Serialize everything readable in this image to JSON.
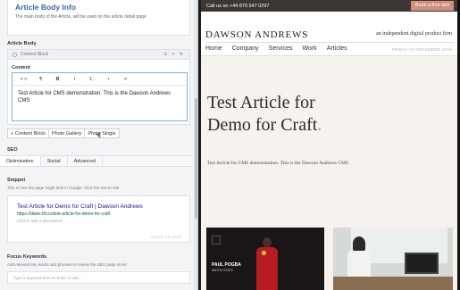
{
  "editor": {
    "section_title": "Article Body Info",
    "section_desc": "The main body of the Article, will be used on the article detail page",
    "article_body_label": "Article Body",
    "block_name": "Content Block",
    "block_tools": "⚙ ▾ ✥",
    "content_label": "Content",
    "toolbar": [
      "<>",
      "¶",
      "B",
      "I",
      "1.",
      "•",
      "∞"
    ],
    "content_text": "Test Article for CMS demonstration. This is the Dawson Andrews CMS",
    "add_buttons": [
      "+ Content Block",
      "Photo Gallery",
      "Photo Single"
    ],
    "seo_label": "SEO",
    "seo_tabs": [
      "Optimisation",
      "Social",
      "Advanced"
    ],
    "snippet_label": "Snippet",
    "snippet_hint": "This is how the page might look in Google. Click the text to edit",
    "snippet_title": "Test Article for Demo for Craft  | Dawson Andrews",
    "snippet_url": "https://daws.frb.io/test-article-for-demo-for-craft",
    "snippet_desc": "Click to add a description!",
    "snippet_click": "CLICK TO EDIT",
    "focus_label": "Focus Keywords",
    "focus_hint": "Add relevant key words and phrases to review the SEO page score",
    "focus_placeholder": "Type a keyword then hit enter to add..."
  },
  "preview": {
    "call_text": "Call us on +44 870 947 0297",
    "book_button": "Book a free slot",
    "logo": "DAWSON ANDREWS",
    "tagline": "an independent digital product firm",
    "nav": [
      "Home",
      "Company",
      "Services",
      "Work",
      "Articles"
    ],
    "date": "FRIDAY 07 DECEMBER 2018",
    "hero_line1": "Test Article for",
    "hero_line2": "Demo for Craft",
    "hero_dot": ".",
    "hero_text": "Test Article for CMS demonstration. This is the Dawson Andrews CMS",
    "thumb1_name": "PAUL POGBA",
    "thumb1_sub": "MATCH STATS",
    "accent_color": "#d08f7d",
    "topbar_color": "#3c3732"
  }
}
